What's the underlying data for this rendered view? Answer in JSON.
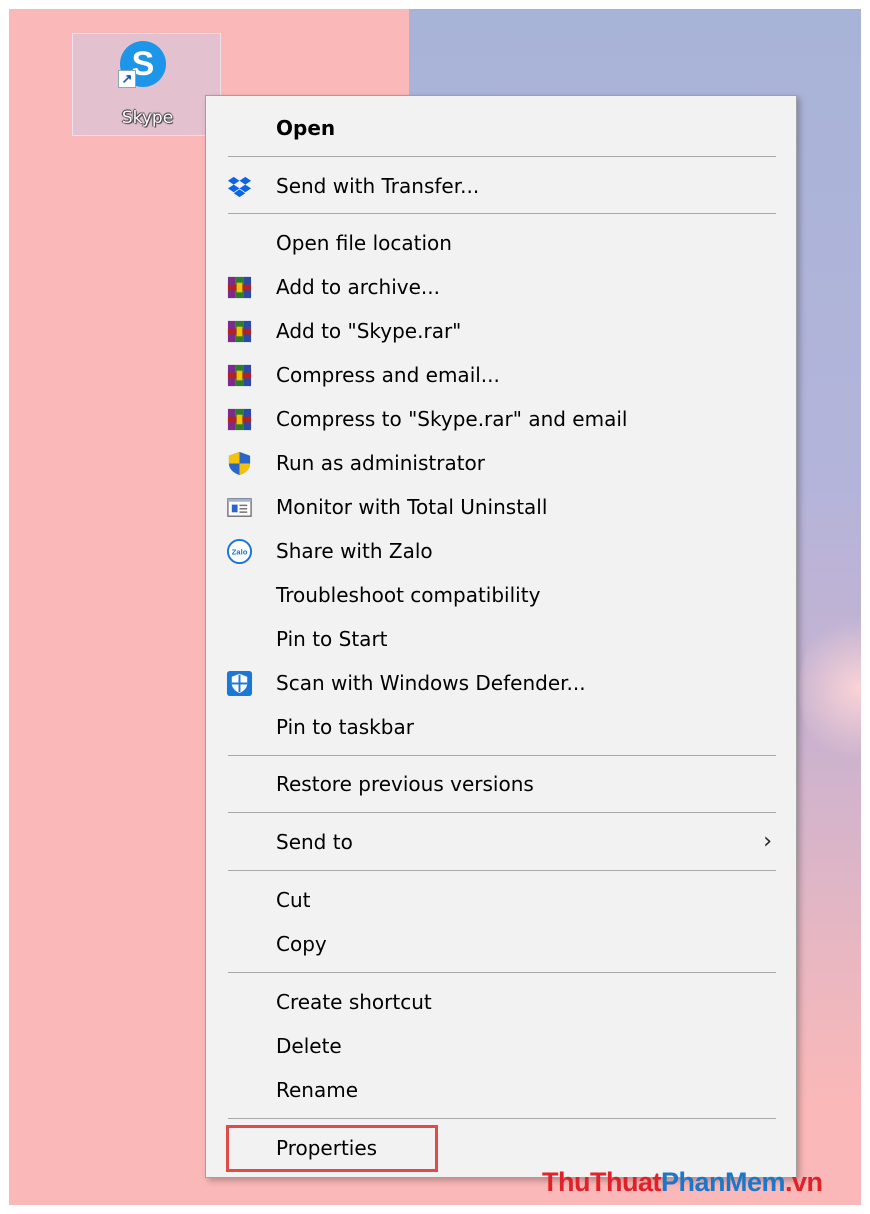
{
  "desktop": {
    "icon_label": "Skype",
    "icon_letter": "S",
    "icon_name": "skype-shortcut-icon",
    "colors": {
      "background": "#fbb8b8",
      "wallpaper_blue": "#a8b3d8",
      "skype_blue": "#1d95e8"
    }
  },
  "context_menu": {
    "items": [
      {
        "label": "Open",
        "bold": true,
        "icon": null
      },
      {
        "label": "Send with Transfer...",
        "icon": "dropbox-icon"
      },
      {
        "label": "Open file location",
        "icon": null
      },
      {
        "label": "Add to archive...",
        "icon": "winrar-icon"
      },
      {
        "label": "Add to \"Skype.rar\"",
        "icon": "winrar-icon"
      },
      {
        "label": "Compress and email...",
        "icon": "winrar-icon"
      },
      {
        "label": "Compress to \"Skype.rar\" and email",
        "icon": "winrar-icon"
      },
      {
        "label": "Run as administrator",
        "icon": "uac-shield-icon"
      },
      {
        "label": "Monitor with Total Uninstall",
        "icon": "total-uninstall-icon"
      },
      {
        "label": "Share with Zalo",
        "icon": "zalo-icon"
      },
      {
        "label": "Troubleshoot compatibility",
        "icon": null
      },
      {
        "label": "Pin to Start",
        "icon": null
      },
      {
        "label": "Scan with Windows Defender...",
        "icon": "windows-defender-icon"
      },
      {
        "label": "Pin to taskbar",
        "icon": null
      },
      {
        "label": "Restore previous versions",
        "icon": null
      },
      {
        "label": "Send to",
        "icon": null,
        "submenu": true
      },
      {
        "label": "Cut",
        "icon": null
      },
      {
        "label": "Copy",
        "icon": null
      },
      {
        "label": "Create shortcut",
        "icon": null
      },
      {
        "label": "Delete",
        "icon": null
      },
      {
        "label": "Rename",
        "icon": null
      },
      {
        "label": "Properties",
        "icon": null,
        "highlighted": true
      }
    ],
    "submenu_arrow": "›",
    "zalo_icon_text": "Zalo",
    "highlight_color": "#e24a4a"
  },
  "watermark": {
    "part1": "ThuThuat",
    "part2": "PhanMem",
    "part3": ".vn",
    "colors": {
      "red": "#e02127",
      "blue": "#1b78c8"
    }
  }
}
